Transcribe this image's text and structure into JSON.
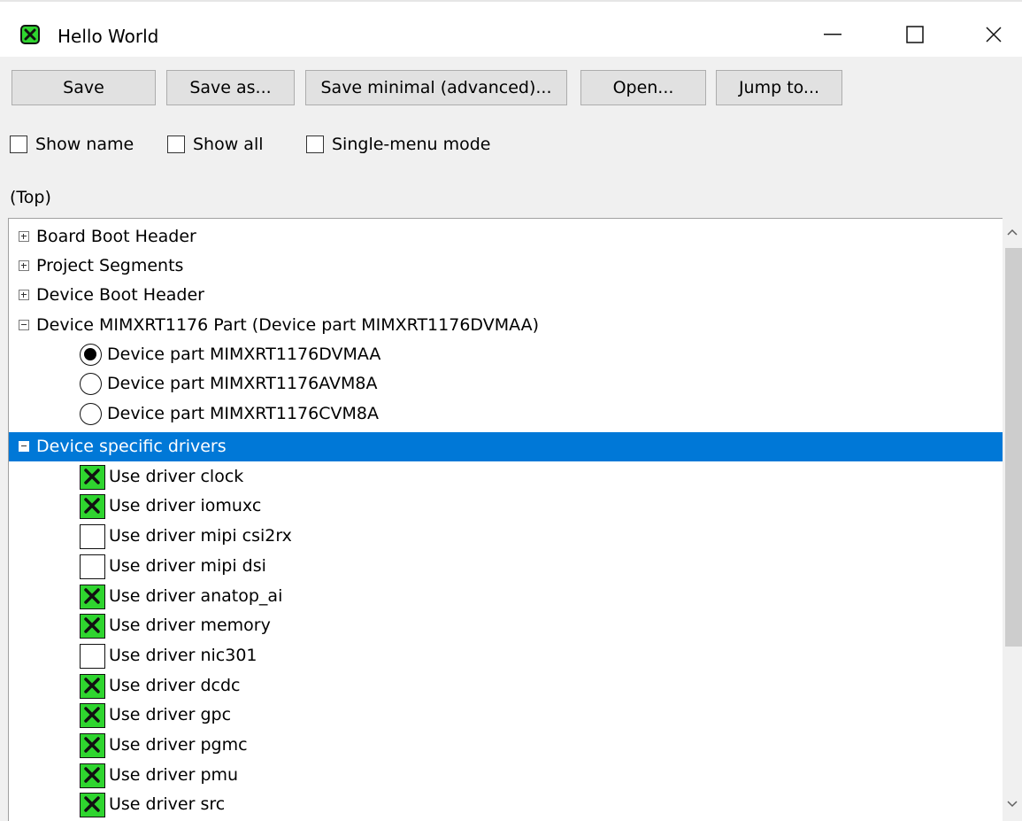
{
  "window": {
    "title": "Hello World"
  },
  "toolbar": {
    "save": "Save",
    "save_as": "Save as...",
    "save_minimal": "Save minimal (advanced)...",
    "open": "Open...",
    "jump_to": "Jump to..."
  },
  "options": {
    "show_name": "Show name",
    "show_all": "Show all",
    "single_menu": "Single-menu mode"
  },
  "breadcrumb": "(Top)",
  "tree": {
    "nodes": [
      {
        "label": "Board Boot Header",
        "expanded": false
      },
      {
        "label": "Project Segments",
        "expanded": false
      },
      {
        "label": "Device Boot Header",
        "expanded": false
      },
      {
        "label": "Device MIMXRT1176 Part (Device part MIMXRT1176DVMAA)",
        "expanded": true
      }
    ],
    "part_options": [
      {
        "label": "Device part MIMXRT1176DVMAA",
        "selected": true
      },
      {
        "label": "Device part MIMXRT1176AVM8A",
        "selected": false
      },
      {
        "label": "Device part MIMXRT1176CVM8A",
        "selected": false
      }
    ],
    "drivers_node": {
      "label": "Device specific drivers",
      "expanded": true,
      "selected": true
    },
    "drivers": [
      {
        "label": "Use driver clock",
        "checked": true
      },
      {
        "label": "Use driver iomuxc",
        "checked": true
      },
      {
        "label": "Use driver mipi csi2rx",
        "checked": false
      },
      {
        "label": "Use driver mipi dsi",
        "checked": false
      },
      {
        "label": "Use driver anatop_ai",
        "checked": true
      },
      {
        "label": "Use driver memory",
        "checked": true
      },
      {
        "label": "Use driver nic301",
        "checked": false
      },
      {
        "label": "Use driver dcdc",
        "checked": true
      },
      {
        "label": "Use driver gpc",
        "checked": true
      },
      {
        "label": "Use driver pgmc",
        "checked": true
      },
      {
        "label": "Use driver pmu",
        "checked": true
      },
      {
        "label": "Use driver src",
        "checked": true
      }
    ]
  },
  "icons": {
    "app": "green-x-icon",
    "check": "green-x-icon",
    "accent": "#0078d7",
    "check_green": "#2fd52f"
  }
}
